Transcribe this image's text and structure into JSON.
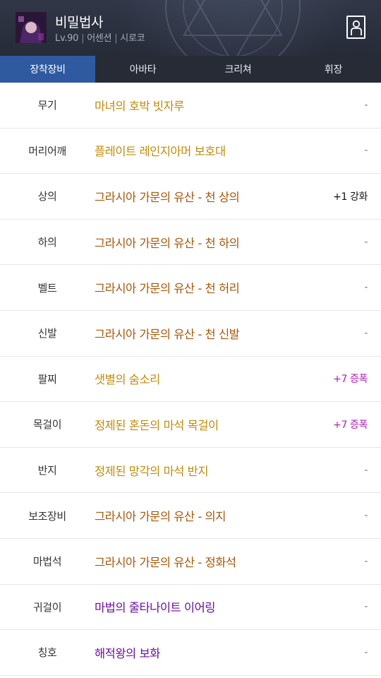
{
  "header": {
    "name": "비밀법사",
    "level": "Lv.90",
    "job": "어센션",
    "guild": "시로코",
    "info_sep": "|"
  },
  "tabs": [
    {
      "label": "장착장비",
      "active": true
    },
    {
      "label": "아바타",
      "active": false
    },
    {
      "label": "크리쳐",
      "active": false
    },
    {
      "label": "휘장",
      "active": false
    }
  ],
  "colors": {
    "unique": "#c08c0a",
    "epic": "#a8570a",
    "legendary": "#6b0f9e",
    "amp": "#b21eb8",
    "active_tab": "#2f5aa0"
  },
  "equipment": [
    {
      "slot": "무기",
      "item": "마녀의 호박 빗자루",
      "rarity": "unique",
      "extra": "-",
      "extra_type": "none"
    },
    {
      "slot": "머리어깨",
      "item": "플레이트 레인지아머 보호대",
      "rarity": "unique",
      "extra": "-",
      "extra_type": "none"
    },
    {
      "slot": "상의",
      "item": "그라시아 가문의 유산 - 천 상의",
      "rarity": "epic",
      "extra": "+1 강화",
      "extra_type": "enhance"
    },
    {
      "slot": "하의",
      "item": "그라시아 가문의 유산 - 천 하의",
      "rarity": "epic",
      "extra": "-",
      "extra_type": "none"
    },
    {
      "slot": "벨트",
      "item": "그라시아 가문의 유산 - 천 허리",
      "rarity": "epic",
      "extra": "-",
      "extra_type": "none"
    },
    {
      "slot": "신발",
      "item": "그라시아 가문의 유산 - 천 신발",
      "rarity": "epic",
      "extra": "-",
      "extra_type": "none"
    },
    {
      "slot": "팔찌",
      "item": "샛별의 숨소리",
      "rarity": "unique",
      "extra": "+7 증폭",
      "extra_type": "amp"
    },
    {
      "slot": "목걸이",
      "item": "정제된 혼돈의 마석 목걸이",
      "rarity": "unique",
      "extra": "+7 증폭",
      "extra_type": "amp"
    },
    {
      "slot": "반지",
      "item": "정제된 망각의 마석 반지",
      "rarity": "unique",
      "extra": "-",
      "extra_type": "none"
    },
    {
      "slot": "보조장비",
      "item": "그라시아 가문의 유산 - 의지",
      "rarity": "epic",
      "extra": "-",
      "extra_type": "none"
    },
    {
      "slot": "마법석",
      "item": "그라시아 가문의 유산 - 정화석",
      "rarity": "epic",
      "extra": "-",
      "extra_type": "none"
    },
    {
      "slot": "귀걸이",
      "item": "마법의 줄타나이트 이어링",
      "rarity": "legendary",
      "extra": "-",
      "extra_type": "none"
    },
    {
      "slot": "칭호",
      "item": "해적왕의 보화",
      "rarity": "legendary",
      "extra": "-",
      "extra_type": "none"
    }
  ]
}
